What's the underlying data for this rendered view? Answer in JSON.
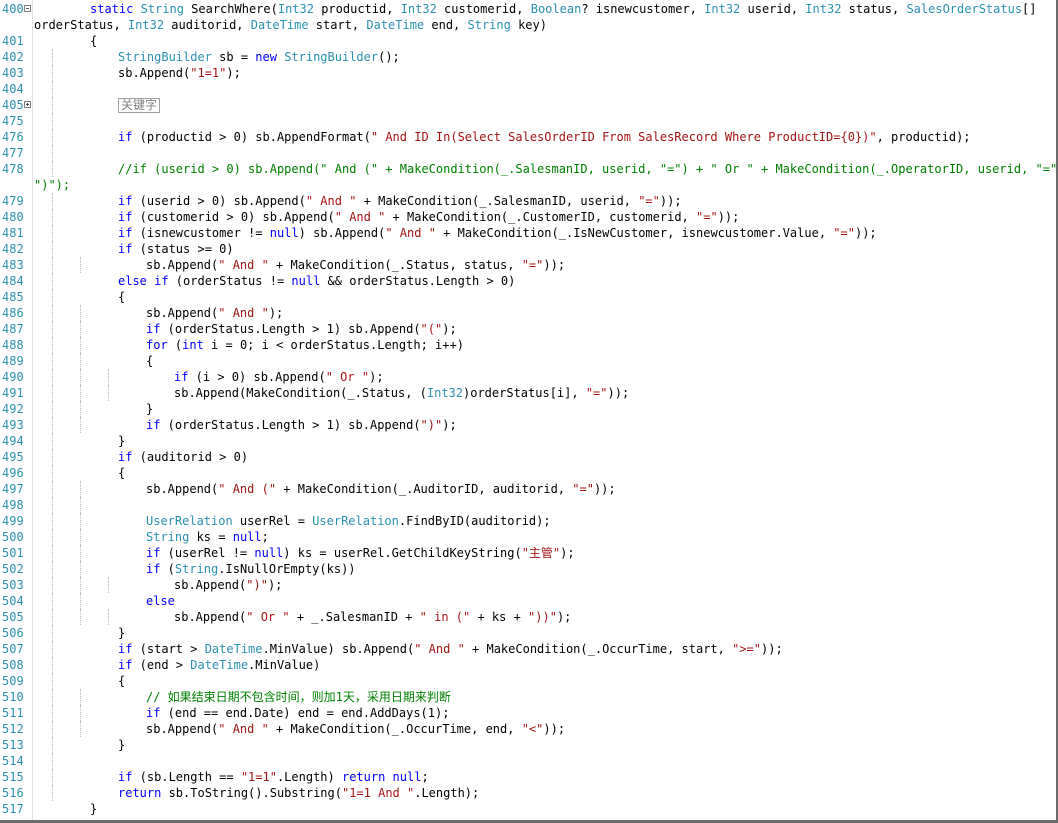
{
  "editor": {
    "lines": [
      {
        "n": "400",
        "i": 1,
        "s": [
          [
            "kw",
            "static "
          ],
          [
            "ty",
            "String"
          ],
          [
            "p",
            " SearchWhere("
          ],
          [
            "ty",
            "Int32"
          ],
          [
            "p",
            " productid, "
          ],
          [
            "ty",
            "Int32"
          ],
          [
            "p",
            " customerid, "
          ],
          [
            "ty",
            "Boolean"
          ],
          [
            "p",
            "? isnewcustomer, "
          ],
          [
            "ty",
            "Int32"
          ],
          [
            "p",
            " userid, "
          ],
          [
            "ty",
            "Int32"
          ],
          [
            "p",
            " status, "
          ],
          [
            "ty",
            "SalesOrderStatus"
          ],
          [
            "p",
            "[]"
          ]
        ],
        "fold": "minus"
      },
      {
        "n": "",
        "i": 0,
        "s": [
          [
            "p",
            "orderStatus, "
          ],
          [
            "ty",
            "Int32"
          ],
          [
            "p",
            " auditorid, "
          ],
          [
            "ty",
            "DateTime"
          ],
          [
            "p",
            " start, "
          ],
          [
            "ty",
            "DateTime"
          ],
          [
            "p",
            " end, "
          ],
          [
            "ty",
            "String"
          ],
          [
            "p",
            " key)"
          ]
        ]
      },
      {
        "n": "401",
        "i": 1,
        "s": [
          [
            "p",
            "{"
          ]
        ]
      },
      {
        "n": "402",
        "i": 2,
        "s": [
          [
            "ty",
            "StringBuilder"
          ],
          [
            "p",
            " sb = "
          ],
          [
            "kw",
            "new "
          ],
          [
            "ty",
            "StringBuilder"
          ],
          [
            "p",
            "();"
          ]
        ]
      },
      {
        "n": "403",
        "i": 2,
        "s": [
          [
            "p",
            "sb.Append("
          ],
          [
            "st",
            "\"1=1\""
          ],
          [
            "p",
            ");"
          ]
        ]
      },
      {
        "n": "404",
        "i": 2,
        "s": []
      },
      {
        "n": "405",
        "i": 2,
        "s": [
          [
            "region",
            "关键字"
          ]
        ],
        "fold": "plus"
      },
      {
        "n": "475",
        "i": 2,
        "s": []
      },
      {
        "n": "476",
        "i": 2,
        "s": [
          [
            "kw",
            "if"
          ],
          [
            "p",
            " (productid > 0) sb.AppendFormat("
          ],
          [
            "st",
            "\" And ID In(Select SalesOrderID From SalesRecord Where ProductID={0})\""
          ],
          [
            "p",
            ", productid);"
          ]
        ]
      },
      {
        "n": "477",
        "i": 2,
        "s": []
      },
      {
        "n": "478",
        "i": 2,
        "s": [
          [
            "cm",
            "//if (userid > 0) sb.Append(\" And (\" + MakeCondition(_.SalesmanID, userid, \"=\") + \" Or \" + MakeCondition(_.OperatorID, userid, \"=\") +"
          ]
        ]
      },
      {
        "n": "",
        "i": 0,
        "s": [
          [
            "cm",
            "\")\");"
          ]
        ]
      },
      {
        "n": "479",
        "i": 2,
        "s": [
          [
            "kw",
            "if"
          ],
          [
            "p",
            " (userid > 0) sb.Append("
          ],
          [
            "st",
            "\" And \""
          ],
          [
            "p",
            " + MakeCondition(_.SalesmanID, userid, "
          ],
          [
            "st",
            "\"=\""
          ],
          [
            "p",
            "));"
          ]
        ]
      },
      {
        "n": "480",
        "i": 2,
        "s": [
          [
            "kw",
            "if"
          ],
          [
            "p",
            " (customerid > 0) sb.Append("
          ],
          [
            "st",
            "\" And \""
          ],
          [
            "p",
            " + MakeCondition(_.CustomerID, customerid, "
          ],
          [
            "st",
            "\"=\""
          ],
          [
            "p",
            "));"
          ]
        ]
      },
      {
        "n": "481",
        "i": 2,
        "s": [
          [
            "kw",
            "if"
          ],
          [
            "p",
            " (isnewcustomer != "
          ],
          [
            "kw",
            "null"
          ],
          [
            "p",
            ") sb.Append("
          ],
          [
            "st",
            "\" And \""
          ],
          [
            "p",
            " + MakeCondition(_.IsNewCustomer, isnewcustomer.Value, "
          ],
          [
            "st",
            "\"=\""
          ],
          [
            "p",
            "));"
          ]
        ]
      },
      {
        "n": "482",
        "i": 2,
        "s": [
          [
            "kw",
            "if"
          ],
          [
            "p",
            " (status >= 0)"
          ]
        ]
      },
      {
        "n": "483",
        "i": 3,
        "s": [
          [
            "p",
            "sb.Append("
          ],
          [
            "st",
            "\" And \""
          ],
          [
            "p",
            " + MakeCondition(_.Status, status, "
          ],
          [
            "st",
            "\"=\""
          ],
          [
            "p",
            "));"
          ]
        ]
      },
      {
        "n": "484",
        "i": 2,
        "s": [
          [
            "kw",
            "else if"
          ],
          [
            "p",
            " (orderStatus != "
          ],
          [
            "kw",
            "null"
          ],
          [
            "p",
            " && orderStatus.Length > 0)"
          ]
        ]
      },
      {
        "n": "485",
        "i": 2,
        "s": [
          [
            "p",
            "{"
          ]
        ]
      },
      {
        "n": "486",
        "i": 3,
        "s": [
          [
            "p",
            "sb.Append("
          ],
          [
            "st",
            "\" And \""
          ],
          [
            "p",
            ");"
          ]
        ]
      },
      {
        "n": "487",
        "i": 3,
        "s": [
          [
            "kw",
            "if"
          ],
          [
            "p",
            " (orderStatus.Length > 1) sb.Append("
          ],
          [
            "st",
            "\"(\""
          ],
          [
            "p",
            ");"
          ]
        ]
      },
      {
        "n": "488",
        "i": 3,
        "s": [
          [
            "kw",
            "for"
          ],
          [
            "p",
            " ("
          ],
          [
            "kw",
            "int"
          ],
          [
            "p",
            " i = 0; i < orderStatus.Length; i++)"
          ]
        ]
      },
      {
        "n": "489",
        "i": 3,
        "s": [
          [
            "p",
            "{"
          ]
        ]
      },
      {
        "n": "490",
        "i": 4,
        "s": [
          [
            "kw",
            "if"
          ],
          [
            "p",
            " (i > 0) sb.Append("
          ],
          [
            "st",
            "\" Or \""
          ],
          [
            "p",
            ");"
          ]
        ]
      },
      {
        "n": "491",
        "i": 4,
        "s": [
          [
            "p",
            "sb.Append(MakeCondition(_.Status, ("
          ],
          [
            "ty",
            "Int32"
          ],
          [
            "p",
            ")orderStatus[i], "
          ],
          [
            "st",
            "\"=\""
          ],
          [
            "p",
            "));"
          ]
        ]
      },
      {
        "n": "492",
        "i": 3,
        "s": [
          [
            "p",
            "}"
          ]
        ]
      },
      {
        "n": "493",
        "i": 3,
        "s": [
          [
            "kw",
            "if"
          ],
          [
            "p",
            " (orderStatus.Length > 1) sb.Append("
          ],
          [
            "st",
            "\")\""
          ],
          [
            "p",
            ");"
          ]
        ]
      },
      {
        "n": "494",
        "i": 2,
        "s": [
          [
            "p",
            "}"
          ]
        ]
      },
      {
        "n": "495",
        "i": 2,
        "s": [
          [
            "kw",
            "if"
          ],
          [
            "p",
            " (auditorid > 0)"
          ]
        ]
      },
      {
        "n": "496",
        "i": 2,
        "s": [
          [
            "p",
            "{"
          ]
        ]
      },
      {
        "n": "497",
        "i": 3,
        "s": [
          [
            "p",
            "sb.Append("
          ],
          [
            "st",
            "\" And (\""
          ],
          [
            "p",
            " + MakeCondition(_.AuditorID, auditorid, "
          ],
          [
            "st",
            "\"=\""
          ],
          [
            "p",
            "));"
          ]
        ]
      },
      {
        "n": "498",
        "i": 3,
        "s": []
      },
      {
        "n": "499",
        "i": 3,
        "s": [
          [
            "ty",
            "UserRelation"
          ],
          [
            "p",
            " userRel = "
          ],
          [
            "ty",
            "UserRelation"
          ],
          [
            "p",
            ".FindByID(auditorid);"
          ]
        ]
      },
      {
        "n": "500",
        "i": 3,
        "s": [
          [
            "ty",
            "String"
          ],
          [
            "p",
            " ks = "
          ],
          [
            "kw",
            "null"
          ],
          [
            "p",
            ";"
          ]
        ]
      },
      {
        "n": "501",
        "i": 3,
        "s": [
          [
            "kw",
            "if"
          ],
          [
            "p",
            " (userRel != "
          ],
          [
            "kw",
            "null"
          ],
          [
            "p",
            ") ks = userRel.GetChildKeyString("
          ],
          [
            "st",
            "\"主管\""
          ],
          [
            "p",
            ");"
          ]
        ]
      },
      {
        "n": "502",
        "i": 3,
        "s": [
          [
            "kw",
            "if"
          ],
          [
            "p",
            " ("
          ],
          [
            "ty",
            "String"
          ],
          [
            "p",
            ".IsNullOrEmpty(ks))"
          ]
        ]
      },
      {
        "n": "503",
        "i": 4,
        "s": [
          [
            "p",
            "sb.Append("
          ],
          [
            "st",
            "\")\""
          ],
          [
            "p",
            ");"
          ]
        ]
      },
      {
        "n": "504",
        "i": 3,
        "s": [
          [
            "kw",
            "else"
          ]
        ]
      },
      {
        "n": "505",
        "i": 4,
        "s": [
          [
            "p",
            "sb.Append("
          ],
          [
            "st",
            "\" Or \""
          ],
          [
            "p",
            " + _.SalesmanID + "
          ],
          [
            "st",
            "\" in (\""
          ],
          [
            "p",
            " + ks + "
          ],
          [
            "st",
            "\"))\""
          ],
          [
            "p",
            ");"
          ]
        ]
      },
      {
        "n": "506",
        "i": 2,
        "s": [
          [
            "p",
            "}"
          ]
        ]
      },
      {
        "n": "507",
        "i": 2,
        "s": [
          [
            "kw",
            "if"
          ],
          [
            "p",
            " (start > "
          ],
          [
            "ty",
            "DateTime"
          ],
          [
            "p",
            ".MinValue) sb.Append("
          ],
          [
            "st",
            "\" And \""
          ],
          [
            "p",
            " + MakeCondition(_.OccurTime, start, "
          ],
          [
            "st",
            "\">=\""
          ],
          [
            "p",
            "));"
          ]
        ]
      },
      {
        "n": "508",
        "i": 2,
        "s": [
          [
            "kw",
            "if"
          ],
          [
            "p",
            " (end > "
          ],
          [
            "ty",
            "DateTime"
          ],
          [
            "p",
            ".MinValue)"
          ]
        ]
      },
      {
        "n": "509",
        "i": 2,
        "s": [
          [
            "p",
            "{"
          ]
        ]
      },
      {
        "n": "510",
        "i": 3,
        "s": [
          [
            "cm",
            "// 如果结束日期不包含时间，则加1天，采用日期来判断"
          ]
        ]
      },
      {
        "n": "511",
        "i": 3,
        "s": [
          [
            "kw",
            "if"
          ],
          [
            "p",
            " (end == end.Date) end = end.AddDays(1);"
          ]
        ]
      },
      {
        "n": "512",
        "i": 3,
        "s": [
          [
            "p",
            "sb.Append("
          ],
          [
            "st",
            "\" And \""
          ],
          [
            "p",
            " + MakeCondition(_.OccurTime, end, "
          ],
          [
            "st",
            "\"<\""
          ],
          [
            "p",
            "));"
          ]
        ]
      },
      {
        "n": "513",
        "i": 2,
        "s": [
          [
            "p",
            "}"
          ]
        ]
      },
      {
        "n": "514",
        "i": 2,
        "s": []
      },
      {
        "n": "515",
        "i": 2,
        "s": [
          [
            "kw",
            "if"
          ],
          [
            "p",
            " (sb.Length == "
          ],
          [
            "st",
            "\"1=1\""
          ],
          [
            "p",
            ".Length) "
          ],
          [
            "kw",
            "return null"
          ],
          [
            "p",
            ";"
          ]
        ]
      },
      {
        "n": "516",
        "i": 2,
        "s": [
          [
            "kw",
            "return"
          ],
          [
            "p",
            " sb.ToString().Substring("
          ],
          [
            "st",
            "\"1=1 And \""
          ],
          [
            "p",
            ".Length);"
          ]
        ]
      },
      {
        "n": "517",
        "i": 1,
        "s": [
          [
            "p",
            "}"
          ]
        ]
      }
    ],
    "colors": {
      "keyword": "#0000ff",
      "type": "#2b91af",
      "string": "#a31515",
      "comment": "#008000",
      "line_number": "#2b91af"
    }
  }
}
